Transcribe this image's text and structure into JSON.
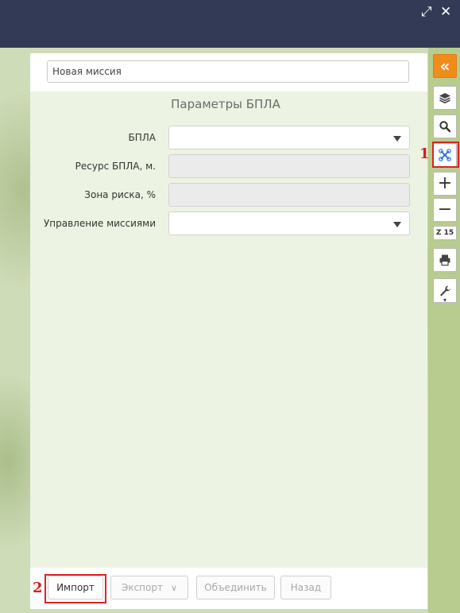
{
  "window": {
    "maximize_glyph": "⤢",
    "close_glyph": "✕"
  },
  "mission": {
    "name_value": "Новая миссия"
  },
  "section": {
    "title": "Параметры БПЛА"
  },
  "fields": {
    "uav_label": "БПЛА",
    "uav_value": "",
    "resource_label": "Ресурс БПЛА, м.",
    "resource_value": "",
    "risk_label": "Зона риска, %",
    "risk_value": "",
    "control_label": "Управление миссиями",
    "control_value": ""
  },
  "footer": {
    "import_label": "Импорт",
    "export_label": "Экспорт",
    "export_caret": "∨",
    "merge_label": "Объединить",
    "back_label": "Назад"
  },
  "toolbar": {
    "collapse_glyph": "«",
    "zoom_in_glyph": "+",
    "zoom_out_glyph": "−",
    "zoom_level": "Z 15",
    "more_glyph": "▾"
  },
  "annotations": {
    "callout_1": "1",
    "callout_2": "2",
    "highlight_color": "#d22222"
  },
  "colors": {
    "titlebar": "#323a56",
    "accent": "#f08c1a",
    "drone_icon": "#2a6fd6"
  }
}
